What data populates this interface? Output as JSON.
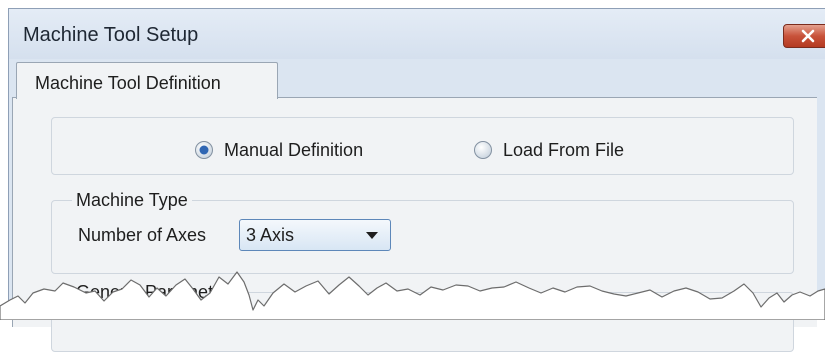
{
  "window": {
    "title": "Machine Tool Setup"
  },
  "tabs": [
    {
      "label": "Machine Tool Definition",
      "active": true
    }
  ],
  "definition_mode": {
    "options": [
      {
        "label": "Manual Definition",
        "selected": true
      },
      {
        "label": "Load From File",
        "selected": false
      }
    ]
  },
  "machine_type": {
    "legend": "Machine Type",
    "axes_label": "Number of Axes",
    "axes_value": "3 Axis"
  },
  "general_parameters": {
    "legend": "General Parameters"
  },
  "icons": {
    "close": "close-icon",
    "radio_selected": "radio-selected-icon",
    "radio_unselected": "radio-unselected-icon",
    "dropdown": "chevron-down-icon"
  },
  "colors": {
    "title_bar": "#dbe5f1",
    "close_button": "#c8523a",
    "panel": "#f1f3f5",
    "select_border": "#5d87b9"
  }
}
